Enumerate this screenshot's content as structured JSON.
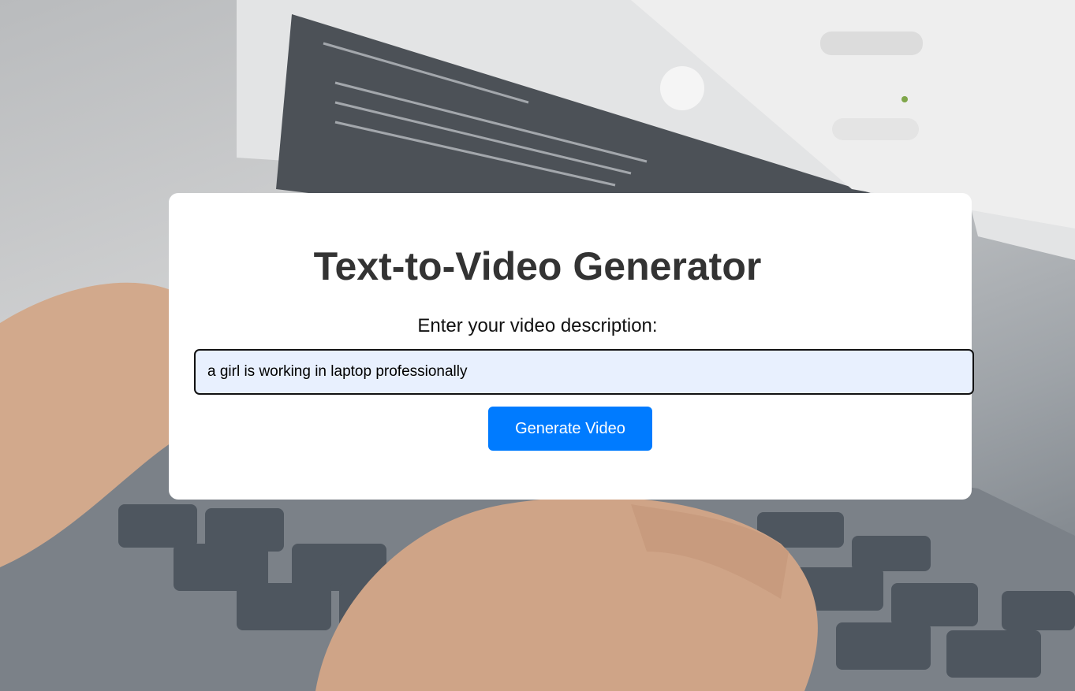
{
  "app": {
    "title": "Text-to-Video Generator"
  },
  "form": {
    "label": "Enter your video description:",
    "input_value": "a girl is working in laptop professionally",
    "button_label": "Generate Video"
  },
  "colors": {
    "button_bg": "#007bff",
    "input_bg": "#e8f0fe",
    "title_text": "#333333"
  },
  "background": {
    "description_icon": "laptop-typing-photo"
  }
}
